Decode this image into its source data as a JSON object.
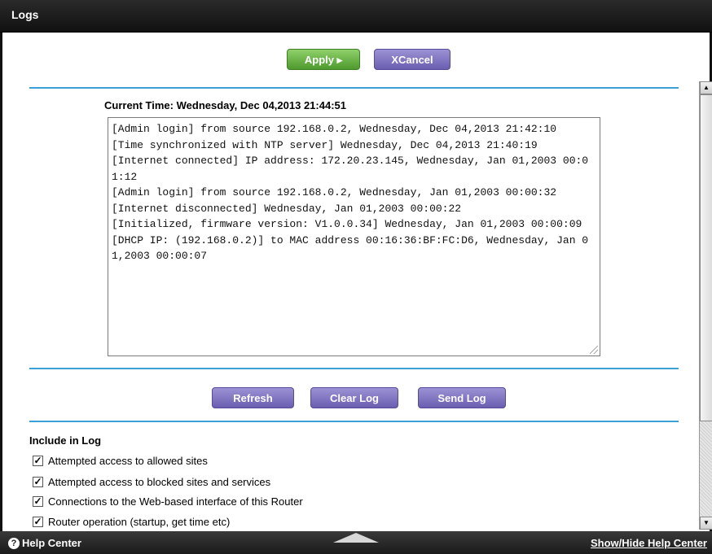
{
  "header": {
    "title": "Logs"
  },
  "actions": {
    "apply_label": "Apply ▸",
    "cancel_label": "Cancel",
    "cancel_icon": "X"
  },
  "current_time": {
    "label": "Current Time:",
    "value": "Wednesday, Dec 04,2013 21:44:51"
  },
  "log_entries": [
    "[Admin login] from source 192.168.0.2, Wednesday, Dec 04,2013 21:42:10",
    "[Time synchronized with NTP server] Wednesday, Dec 04,2013 21:40:19",
    "[Internet connected] IP address: 172.20.23.145, Wednesday, Jan 01,2003 00:01:12",
    "[Admin login] from source 192.168.0.2, Wednesday, Jan 01,2003 00:00:32",
    "[Internet disconnected] Wednesday, Jan 01,2003 00:00:22",
    "[Initialized, firmware version: V1.0.0.34] Wednesday, Jan 01,2003 00:00:09",
    "[DHCP IP: (192.168.0.2)] to MAC address 00:16:36:BF:FC:D6, Wednesday, Jan 01,2003 00:00:07"
  ],
  "log_buttons": {
    "refresh": "Refresh",
    "clear": "Clear Log",
    "send": "Send Log"
  },
  "include": {
    "heading": "Include in Log",
    "options": [
      {
        "label": "Attempted access to allowed sites",
        "checked": true
      },
      {
        "label": "Attempted access to blocked sites and services",
        "checked": true
      },
      {
        "label": "Connections to the Web-based interface of this Router",
        "checked": true
      },
      {
        "label": "Router operation (startup, get time etc)",
        "checked": true
      }
    ]
  },
  "footer": {
    "help_label": "Help Center",
    "toggle_label": "Show/Hide Help Center"
  },
  "colors": {
    "accent_rule": "#3aa0d6",
    "apply_green": "#5fae3a",
    "purple": "#7a6fc0"
  }
}
